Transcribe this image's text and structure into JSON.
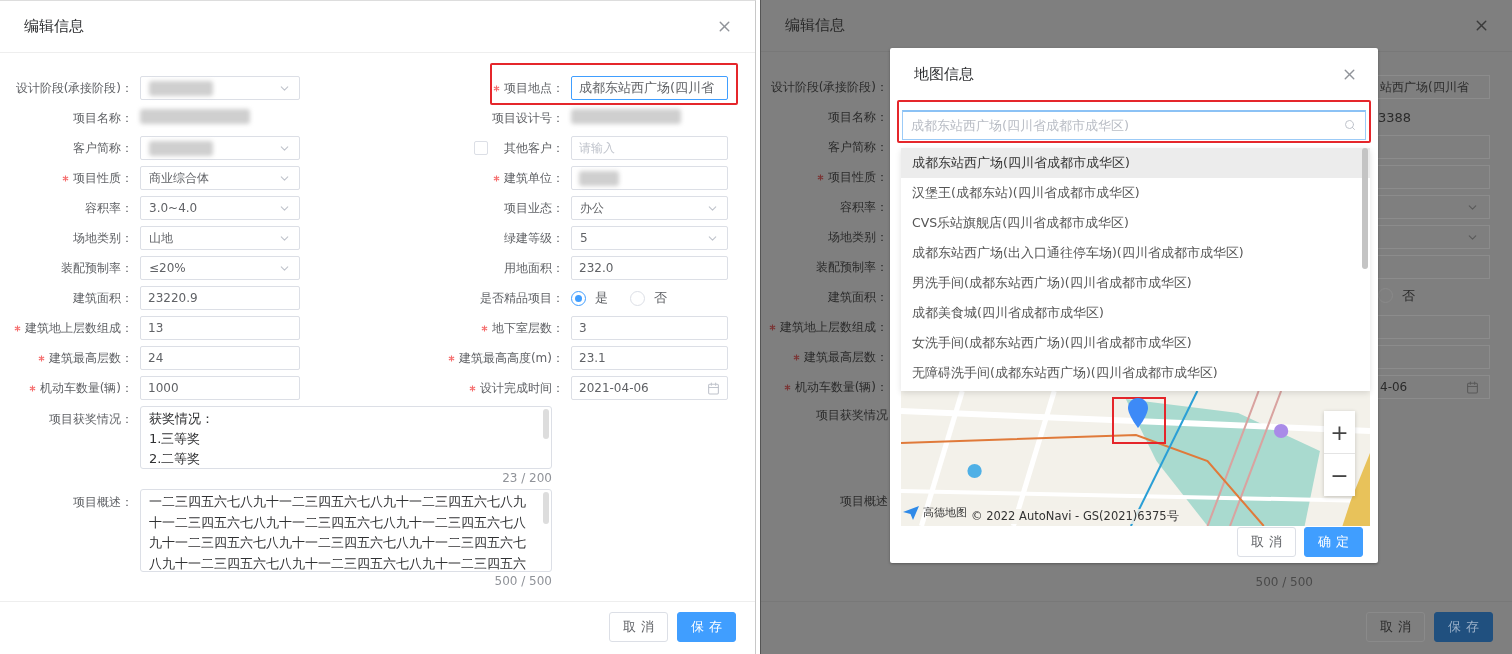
{
  "edit_dialog": {
    "title": "编辑信息",
    "rows": [
      {
        "left": {
          "label": "设计阶段(承接阶段)：",
          "required": false,
          "kind": "select",
          "blurred": true
        },
        "right": {
          "label": "项目地点：",
          "required": true,
          "kind": "input",
          "value": "成都东站西广场(四川省",
          "focused": true,
          "highlighted": true
        }
      },
      {
        "left": {
          "label": "项目名称：",
          "required": false,
          "kind": "text",
          "blurred": true
        },
        "right": {
          "label": "项目设计号：",
          "required": false,
          "kind": "text",
          "blurred": true
        }
      },
      {
        "left": {
          "label": "客户简称：",
          "required": false,
          "kind": "select",
          "blurred": true
        },
        "right": {
          "label": "其他客户：",
          "required": false,
          "kind": "checkbox-input",
          "checked": false,
          "placeholder": "请输入"
        }
      },
      {
        "left": {
          "label": "项目性质：",
          "required": true,
          "kind": "select",
          "value": "商业综合体"
        },
        "right": {
          "label": "建筑单位：",
          "required": true,
          "kind": "input",
          "blurred": true
        }
      },
      {
        "left": {
          "label": "容积率：",
          "required": false,
          "kind": "select",
          "value": "3.0~4.0"
        },
        "right": {
          "label": "项目业态：",
          "required": false,
          "kind": "select",
          "value": "办公"
        }
      },
      {
        "left": {
          "label": "场地类别：",
          "required": false,
          "kind": "select",
          "value": "山地"
        },
        "right": {
          "label": "绿建等级：",
          "required": false,
          "kind": "select",
          "value": "5"
        }
      },
      {
        "left": {
          "label": "装配预制率：",
          "required": false,
          "kind": "select",
          "value": "≤20%"
        },
        "right": {
          "label": "用地面积：",
          "required": false,
          "kind": "input",
          "value": "232.0"
        }
      },
      {
        "left": {
          "label": "建筑面积：",
          "required": false,
          "kind": "input",
          "value": "23220.9"
        },
        "right": {
          "label": "是否精品项目：",
          "required": false,
          "kind": "radio",
          "options": [
            {
              "label": "是",
              "selected": true
            },
            {
              "label": "否",
              "selected": false
            }
          ]
        }
      },
      {
        "left": {
          "label": "建筑地上层数组成：",
          "required": true,
          "kind": "input",
          "value": "13"
        },
        "right": {
          "label": "地下室层数：",
          "required": true,
          "kind": "input",
          "value": "3"
        }
      },
      {
        "left": {
          "label": "建筑最高层数：",
          "required": true,
          "kind": "input",
          "value": "24"
        },
        "right": {
          "label": "建筑最高高度(m)：",
          "required": true,
          "kind": "input",
          "value": "23.1"
        }
      },
      {
        "left": {
          "label": "机动车数量(辆)：",
          "required": true,
          "kind": "input",
          "value": "1000"
        },
        "right": {
          "label": "设计完成时间：",
          "required": true,
          "kind": "date",
          "value": "2021-04-06"
        }
      }
    ],
    "textareas": [
      {
        "label": "项目获奖情况：",
        "lines": [
          "获奖情况：",
          "1.三等奖",
          "2.二等奖"
        ],
        "counter": "23 / 200"
      },
      {
        "label": "项目概述：",
        "lines": [
          "一二三四五六七八九十一二三四五六七八九十一二三四五六七八九",
          "十一二三四五六七八九十一二三四五六七八九十一二三四五六七八",
          "九十一二三四五六七八九十一二三四五六七八九十一二三四五六七",
          "八九十一二三四五六七八九十一二三四五六七八九十一二三四五六"
        ],
        "counter": "500 / 500"
      }
    ],
    "buttons": [
      {
        "label": "取 消",
        "kind": "default"
      },
      {
        "label": "保 存",
        "kind": "primary"
      }
    ]
  },
  "backdrop_dialog": {
    "title": "编辑信息",
    "rows": [
      {
        "label": "设计阶段(承接阶段)：",
        "required": false,
        "fragment": {
          "kind": "input",
          "value": "站西广场(四川省"
        }
      },
      {
        "label": "项目名称：",
        "required": false,
        "fragment": {
          "kind": "text",
          "value": "3388"
        }
      },
      {
        "label": "客户简称：",
        "required": false,
        "fragment": {
          "kind": "input"
        }
      },
      {
        "label": "项目性质：",
        "required": true,
        "fragment": {
          "kind": "input"
        }
      },
      {
        "label": "容积率：",
        "required": false,
        "fragment": {
          "kind": "select"
        }
      },
      {
        "label": "场地类别：",
        "required": false,
        "fragment": {
          "kind": "select"
        }
      },
      {
        "label": "装配预制率：",
        "required": false,
        "fragment": {
          "kind": "input"
        }
      },
      {
        "label": "建筑面积：",
        "required": false,
        "fragment": {
          "kind": "radio",
          "label": "否",
          "selected": false
        }
      },
      {
        "label": "建筑地上层数组成：",
        "required": true,
        "fragment": {
          "kind": "input"
        }
      },
      {
        "label": "建筑最高层数：",
        "required": true,
        "fragment": {
          "kind": "input"
        }
      },
      {
        "label": "机动车数量(辆)：",
        "required": true,
        "fragment": {
          "kind": "date",
          "value": "4-06"
        }
      }
    ],
    "textarea_labels": [
      "项目获奖情况",
      "项目概述"
    ],
    "counter": "500 / 500",
    "buttons": [
      {
        "label": "取 消",
        "kind": "default"
      },
      {
        "label": "保 存",
        "kind": "primary"
      }
    ]
  },
  "map_dialog": {
    "title": "地图信息",
    "search": {
      "placeholder": "成都东站西广场(四川省成都市成华区)",
      "highlighted": true
    },
    "suggestions": [
      {
        "text": "成都东站西广场(四川省成都市成华区)",
        "selected": true
      },
      {
        "text": "汉堡王(成都东站)(四川省成都市成华区)",
        "selected": false
      },
      {
        "text": "CVS乐站旗舰店(四川省成都市成华区)",
        "selected": false
      },
      {
        "text": "成都东站西广场(出入口通往停车场)(四川省成都市成华区)",
        "selected": false
      },
      {
        "text": "男洗手间(成都东站西广场)(四川省成都市成华区)",
        "selected": false
      },
      {
        "text": "成都美食城(四川省成都市成华区)",
        "selected": false
      },
      {
        "text": "女洗手间(成都东站西广场)(四川省成都市成华区)",
        "selected": false
      },
      {
        "text": "无障碍洗手间(成都东站西广场)(四川省成都市成华区)",
        "selected": false
      }
    ],
    "map": {
      "kind": "picture",
      "marker_highlighted": true,
      "zoom_in": "+",
      "zoom_out": "−",
      "logo": "高德地图",
      "attribution": "© 2022 AutoNavi - GS(2021)6375号"
    },
    "buttons": [
      {
        "label": "取 消",
        "kind": "default"
      },
      {
        "label": "确 定",
        "kind": "primary"
      }
    ]
  }
}
